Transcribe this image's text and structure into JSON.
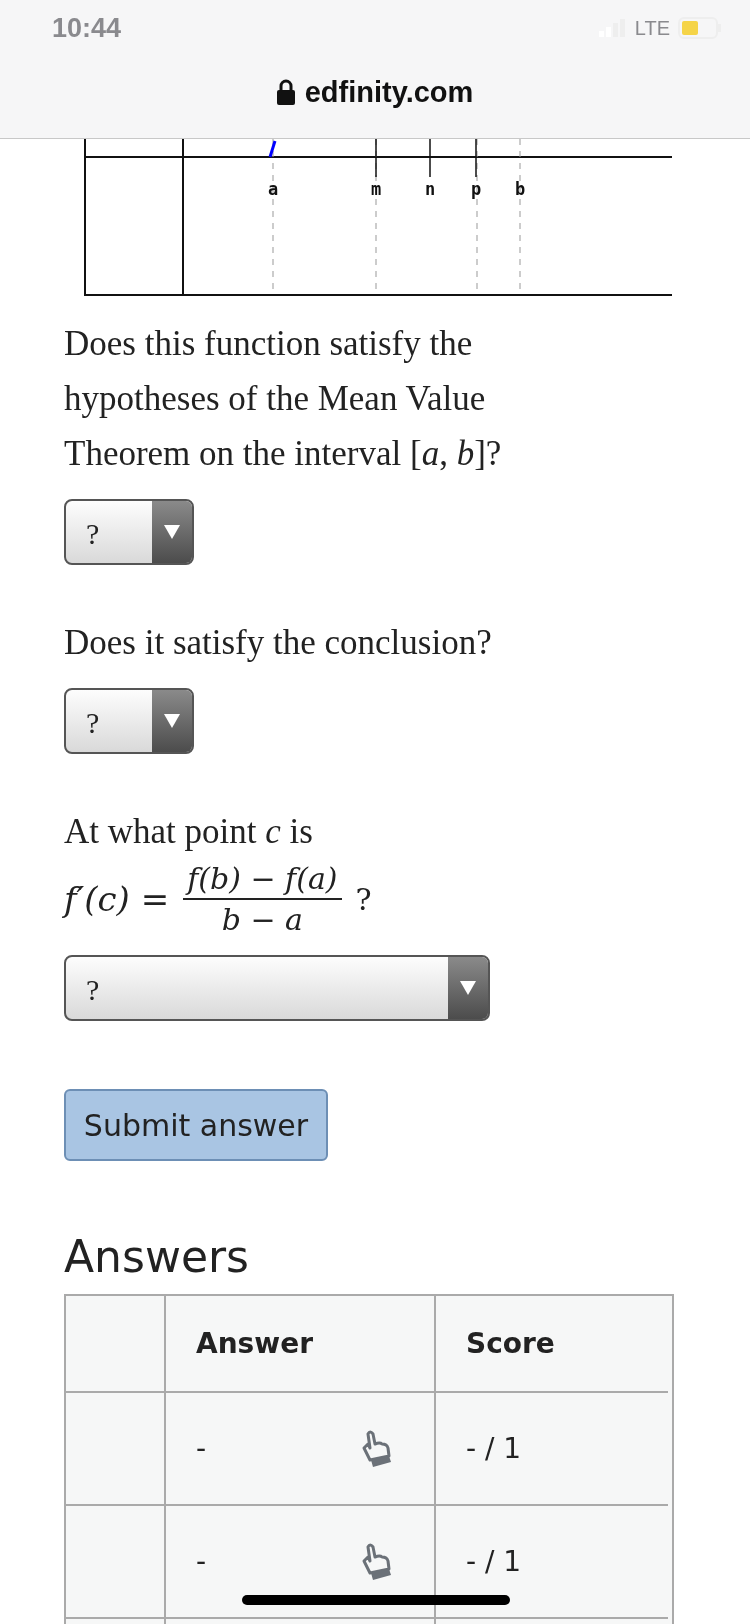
{
  "status_bar": {
    "time": "10:44",
    "network": "LTE"
  },
  "address_bar": {
    "url": "edfinity.com"
  },
  "graph": {
    "labels": [
      "a",
      "m",
      "n",
      "p",
      "b"
    ]
  },
  "questions": [
    {
      "text": "Does this function satisfy the hypotheses of the Mean Value Theorem on the interval [*a*, *b*]?",
      "dropdown": {
        "value": "?",
        "wide": false
      }
    },
    {
      "text": "Does it satisfy the conclusion?",
      "dropdown": {
        "value": "?",
        "wide": false
      }
    },
    {
      "text": "At what point *c* is",
      "formula": {
        "lhs": "f′(c) =",
        "numerator": "f(b) − f(a)",
        "denominator": "b − a",
        "suffix": "?"
      },
      "dropdown": {
        "value": "?",
        "wide": true
      }
    }
  ],
  "submit_button": "Submit answer",
  "answers": {
    "title": "Answers",
    "columns": [
      "Answer",
      "Score"
    ],
    "rows": [
      {
        "answer": "-",
        "score": "- / 1"
      },
      {
        "answer": "-",
        "score": "- / 1"
      }
    ]
  }
}
